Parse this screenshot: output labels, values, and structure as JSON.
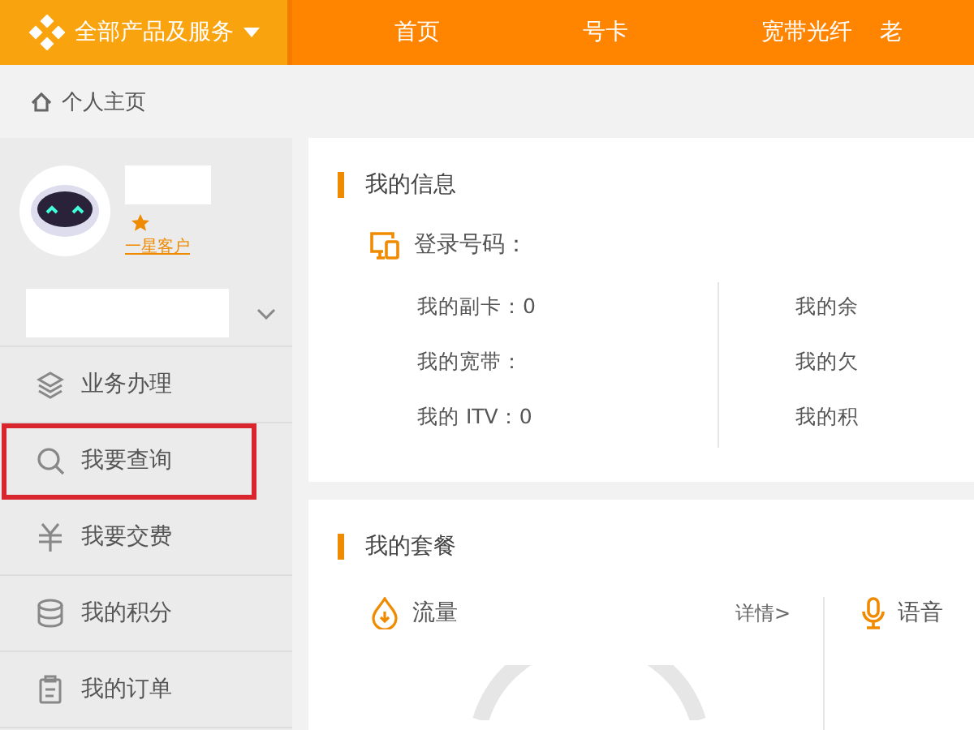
{
  "top_nav": {
    "products_menu": "全部产品及服务",
    "items": [
      {
        "label": "首页"
      },
      {
        "label": "号卡"
      },
      {
        "label": "宽带光纤"
      },
      {
        "label": "老"
      }
    ]
  },
  "breadcrumb": "个人主页",
  "profile": {
    "level_link": "一星客户"
  },
  "sidebar": {
    "items": [
      {
        "label": "业务办理",
        "kind": "layers",
        "highlighted": false
      },
      {
        "label": "我要查询",
        "kind": "search",
        "highlighted": true
      },
      {
        "label": "我要交费",
        "kind": "yuan",
        "highlighted": false
      },
      {
        "label": "我的积分",
        "kind": "database",
        "highlighted": false
      },
      {
        "label": "我的订单",
        "kind": "clipboard",
        "highlighted": false
      }
    ]
  },
  "my_info": {
    "title": "我的信息",
    "login_number_label": "登录号码：",
    "left_rows": [
      "我的副卡：0",
      "我的宽带：",
      "我的 ITV：0"
    ],
    "right_rows": [
      "我的余",
      "我的欠",
      "我的积"
    ]
  },
  "my_plan": {
    "title": "我的套餐",
    "data_label": "流量",
    "details_link": "详情>",
    "voice_label": "语音"
  }
}
